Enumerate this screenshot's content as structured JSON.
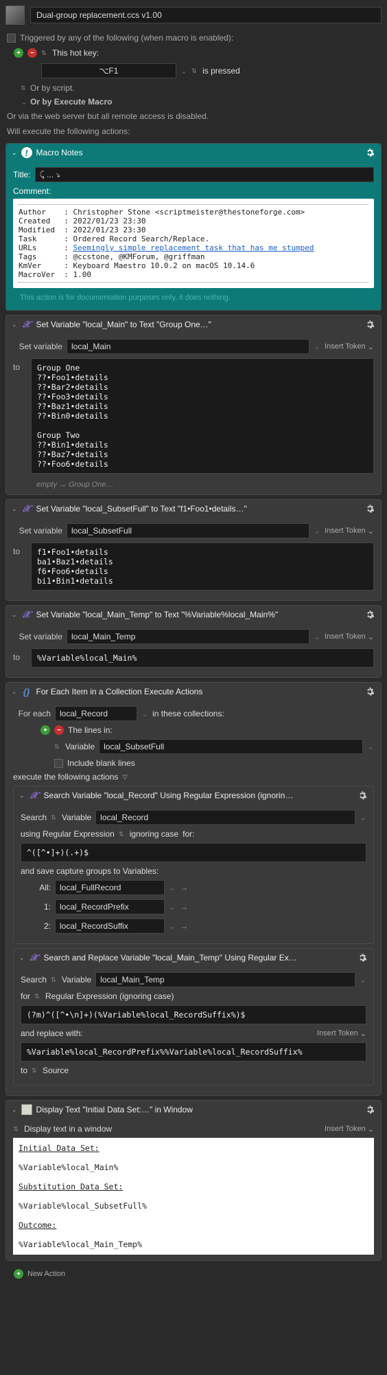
{
  "title": "Dual-group replacement.ccs v1.00",
  "triggered_label": "Triggered by any of the following (when macro is enabled):",
  "hotkey_label": "This hot key:",
  "hotkey_value": "⌥F1",
  "hotkey_suffix": "is pressed",
  "or_script": "Or by script.",
  "or_execute": "Or by Execute Macro",
  "or_web": "Or via the web server but all remote access is disabled.",
  "execute_label": "Will execute the following actions:",
  "macro_notes": {
    "title": "Macro Notes",
    "title_field_label": "Title:",
    "title_field_value": "⤹ ... ⤵",
    "comment_label": "Comment:",
    "author_l": "Author",
    "author_v": "Christopher Stone <scriptmeister@thestoneforge.com>",
    "created_l": "Created",
    "created_v": "2022/01/23 23:30",
    "modified_l": "Modified",
    "modified_v": "2022/01/23 23:30",
    "task_l": "Task",
    "task_v": "Ordered Record Search/Replace.",
    "urls_l": "URLs",
    "urls_v": "Seemingly simple replacement task that has me stumped",
    "tags_l": "Tags",
    "tags_v": "@ccstone, @KMForum, @griffman",
    "kmver_l": "KmVer",
    "kmver_v": "Keyboard Maestro 10.0.2 on macOS 10.14.6",
    "macrover_l": "MacroVer",
    "macrover_v": "1.00",
    "footer": "This action is for documentation purposes only, it does nothing."
  },
  "labels": {
    "set_var": "Set variable",
    "insert_token": "Insert Token",
    "to": "to",
    "for_each": "For each",
    "in_collections": "in these collections:",
    "lines_in": "The lines in:",
    "variable": "Variable",
    "include_blank": "Include blank lines",
    "execute_actions": "execute the following actions",
    "search": "Search",
    "using_regex": "using Regular Expression",
    "ignoring_case": "ignoring case",
    "for": "for:",
    "save_groups": "and save capture groups to Variables:",
    "all": "All:",
    "one": "1:",
    "two": "2:",
    "for2": "for",
    "regex_ign": "Regular Expression (ignoring case)",
    "replace_with": "and replace with:",
    "to_source": "Source",
    "display_sel": "Display text in a window",
    "new_action": "New Action",
    "empty": "empty",
    "hint_arrow": "→",
    "hint_text": "Group One…"
  },
  "set_main": {
    "title": "Set Variable \"local_Main\" to Text \"Group One…\"",
    "var": "local_Main",
    "text": "Group One\n??•Foo1•details\n??•Bar2•details\n??•Foo3•details\n??•Baz1•details\n??•Bin0•details\n\nGroup Two\n??•Bin1•details\n??•Baz7•details\n??•Foo6•details"
  },
  "set_subset": {
    "title": "Set Variable \"local_SubsetFull\" to Text \"f1•Foo1•details…\"",
    "var": "local_SubsetFull",
    "text": "f1•Foo1•details\nba1•Baz1•details\nf6•Foo6•details\nbi1•Bin1•details"
  },
  "set_temp": {
    "title": "Set Variable \"local_Main_Temp\" to Text \"%Variable%local_Main%\"",
    "var": "local_Main_Temp",
    "text": "%Variable%local_Main%"
  },
  "foreach": {
    "title": "For Each Item in a Collection Execute Actions",
    "var": "local_Record",
    "subset_var": "local_SubsetFull"
  },
  "search1": {
    "title": "Search Variable \"local_Record\" Using Regular Expression (ignorin…",
    "var": "local_Record",
    "regex": "^([^•]+)(.+)$",
    "all": "local_FullRecord",
    "g1": "local_RecordPrefix",
    "g2": "local_RecordSuffix"
  },
  "search2": {
    "title": "Search and Replace Variable \"local_Main_Temp\" Using Regular Ex…",
    "var": "local_Main_Temp",
    "regex": "(?m)^([^•\\n]+)(%Variable%local_RecordSuffix%)$",
    "replace": "%Variable%local_RecordPrefix%%Variable%local_RecordSuffix%"
  },
  "display": {
    "title": "Display Text \"Initial Data Set:…\" in Window",
    "l1": "Initial Data Set:",
    "l2": "%Variable%local_Main%",
    "l3": "Substitution Data Set:",
    "l4": "%Variable%local_SubsetFull%",
    "l5": "Outcome:",
    "l6": "%Variable%local_Main_Temp%"
  }
}
